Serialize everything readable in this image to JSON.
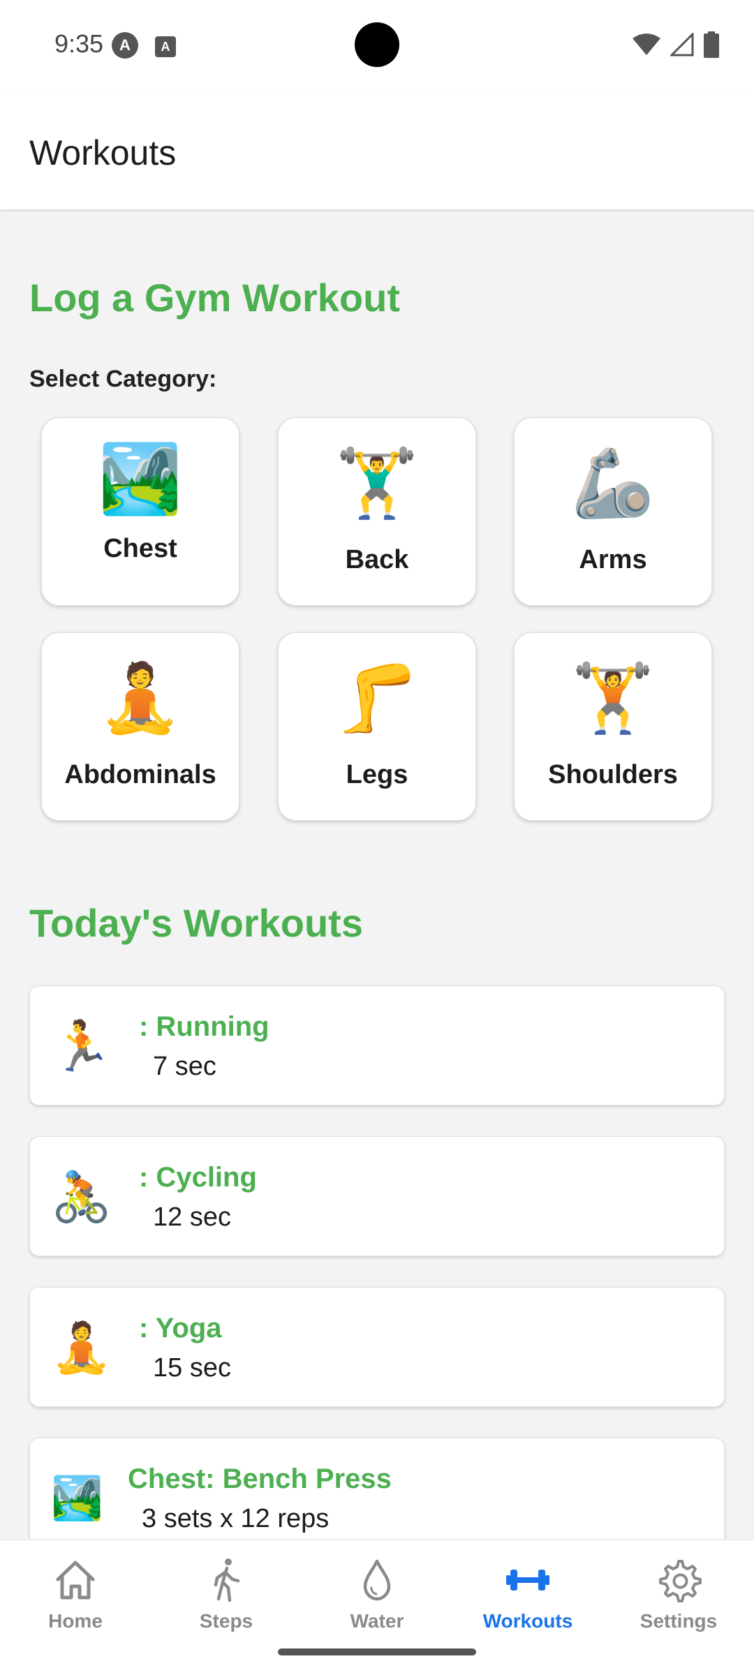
{
  "status_bar": {
    "time": "9:35",
    "icon_a": "A",
    "icon_b": "A"
  },
  "app_bar": {
    "title": "Workouts"
  },
  "log_section": {
    "title": "Log a Gym Workout",
    "select_label": "Select Category:",
    "categories": [
      {
        "label": "Chest",
        "emoji": "🏞️",
        "icon": "farm-scene-icon"
      },
      {
        "label": "Back",
        "emoji": "🏋️‍♂️",
        "icon": "weightlifter-icon"
      },
      {
        "label": "Arms",
        "emoji": "🦾",
        "icon": "mechanical-arm-icon"
      },
      {
        "label": "Abdominals",
        "emoji": "🧘",
        "icon": "meditation-icon"
      },
      {
        "label": "Legs",
        "emoji": "🦵",
        "icon": "leg-icon"
      },
      {
        "label": "Shoulders",
        "emoji": "🏋️",
        "icon": "weightlifter-icon"
      }
    ]
  },
  "today_section": {
    "title": "Today's Workouts",
    "workouts": [
      {
        "name": ": Running",
        "detail": "7 sec",
        "emoji": "🏃",
        "icon": "running-icon"
      },
      {
        "name": ": Cycling",
        "detail": "12 sec",
        "emoji": "🚴",
        "icon": "cycling-icon"
      },
      {
        "name": ": Yoga",
        "detail": "15 sec",
        "emoji": "🧘",
        "icon": "yoga-icon"
      },
      {
        "name": "Chest: Bench Press",
        "detail": "3 sets x 12 reps",
        "emoji": "🏞️",
        "icon": "farm-scene-icon"
      }
    ]
  },
  "bottom_nav": {
    "items": [
      {
        "label": "Home",
        "icon": "home-icon",
        "active": false
      },
      {
        "label": "Steps",
        "icon": "walking-icon",
        "active": false
      },
      {
        "label": "Water",
        "icon": "water-drop-icon",
        "active": false
      },
      {
        "label": "Workouts",
        "icon": "dumbbell-icon",
        "active": true
      },
      {
        "label": "Settings",
        "icon": "gear-icon",
        "active": false
      }
    ]
  },
  "colors": {
    "accent_green": "#4caf50",
    "active_blue": "#1a73e8",
    "inactive_gray": "#8a8a8a"
  }
}
